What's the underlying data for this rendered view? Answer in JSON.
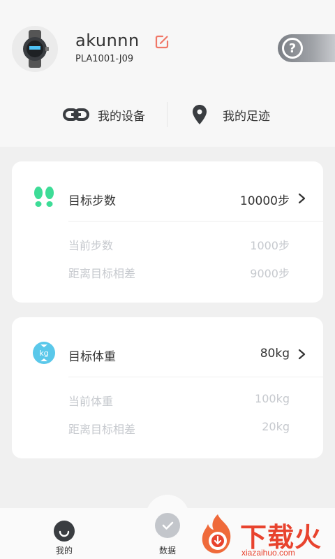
{
  "profile": {
    "username": "akunnn",
    "device_code": "PLA1001-J09",
    "avatar_icon": "smartwatch-avatar",
    "edit_icon": "edit-icon",
    "help_icon": "question-icon"
  },
  "quick_links": [
    {
      "label": "我的设备",
      "icon": "link-icon"
    },
    {
      "label": "我的足迹",
      "icon": "location-pin-icon"
    }
  ],
  "cards": {
    "steps": {
      "title": "目标步数",
      "target": "10000步",
      "rows": [
        {
          "label": "当前步数",
          "value": "1000步"
        },
        {
          "label": "距离目标相差",
          "value": "9000步"
        }
      ],
      "icon": "footprints-icon",
      "accent": "#3ddc97"
    },
    "weight": {
      "title": "目标体重",
      "target": "80kg",
      "rows": [
        {
          "label": "当前体重",
          "value": "100kg"
        },
        {
          "label": "距离目标相差",
          "value": "20kg"
        }
      ],
      "icon": "kg-scale-icon",
      "icon_text": "kg",
      "accent": "#5ac8ea"
    }
  },
  "tabbar": {
    "tabs": [
      {
        "label": "我的",
        "icon": "smile-icon"
      },
      {
        "label": "数据",
        "icon": "check-icon"
      }
    ]
  },
  "watermark": {
    "logo_text": "下载火",
    "url": "xiazaihuo.com"
  }
}
